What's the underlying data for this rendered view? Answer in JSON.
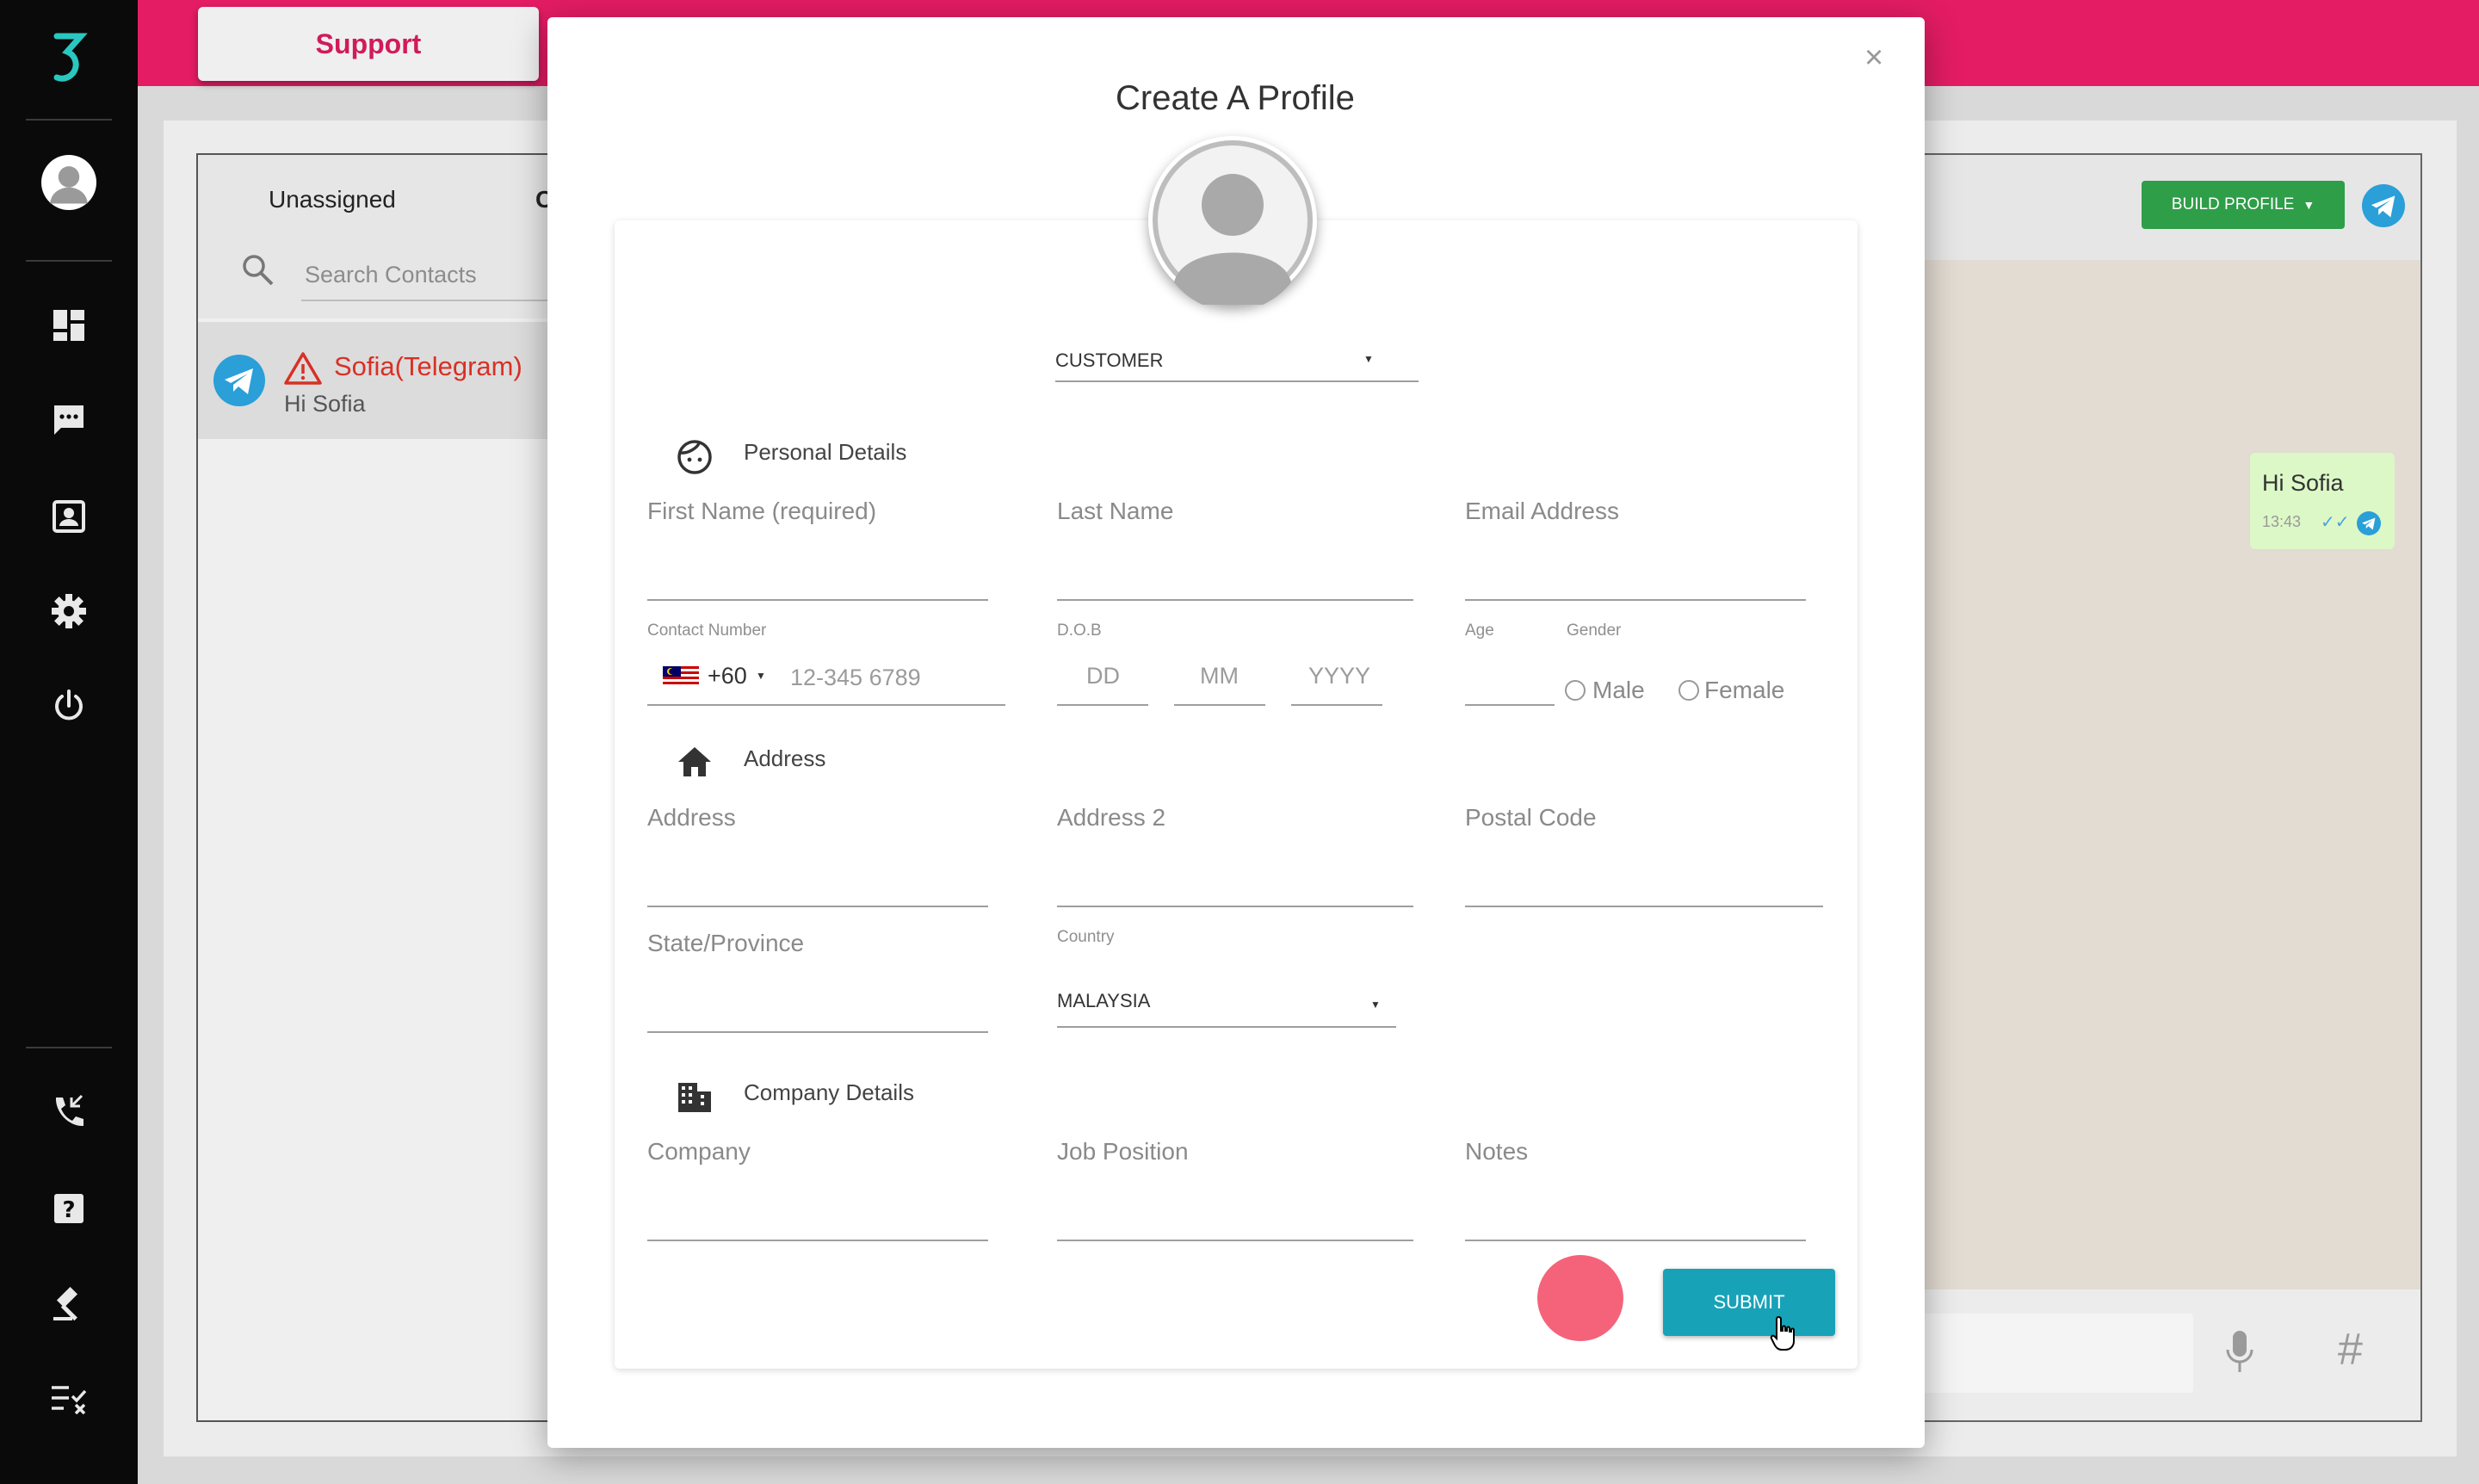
{
  "app": {
    "tab_label": "Support"
  },
  "sidebar": {
    "icons": [
      "logo-icon",
      "avatar",
      "dashboard-icon",
      "chat-icon",
      "contacts-icon",
      "settings-icon",
      "power-icon",
      "phone-icon",
      "help-icon",
      "gavel-icon",
      "checklist-icon"
    ]
  },
  "contacts": {
    "tab_unassigned": "Unassigned",
    "tab_other": "C",
    "search_placeholder": "Search Contacts",
    "items": [
      {
        "name": "Sofia(Telegram)",
        "preview": "Hi Sofia"
      }
    ]
  },
  "chat": {
    "build_profile_label": "BUILD PROFILE",
    "message_text": "Hi Sofia",
    "message_time": "13:43"
  },
  "modal": {
    "title": "Create A Profile",
    "close_label": "×",
    "profile_type": "CUSTOMER",
    "sections": {
      "personal": "Personal Details",
      "address": "Address",
      "company": "Company Details"
    },
    "fields": {
      "first_name": "First Name (required)",
      "last_name": "Last Name",
      "email": "Email Address",
      "contact_label": "Contact Number",
      "country_code": "+60",
      "phone_placeholder": "12-345 6789",
      "dob_label": "D.O.B",
      "dd": "DD",
      "mm": "MM",
      "yyyy": "YYYY",
      "age_label": "Age",
      "gender_label": "Gender",
      "male": "Male",
      "female": "Female",
      "address": "Address",
      "address2": "Address 2",
      "postal": "Postal Code",
      "state": "State/Province",
      "country_label": "Country",
      "country_value": "MALAYSIA",
      "company": "Company",
      "job": "Job Position",
      "notes": "Notes"
    },
    "submit_label": "SUBMIT"
  },
  "colors": {
    "accent_pink": "#e31c63",
    "submit": "#17a2b8",
    "build_profile": "#2e9e48",
    "telegram": "#2a9fd8"
  }
}
